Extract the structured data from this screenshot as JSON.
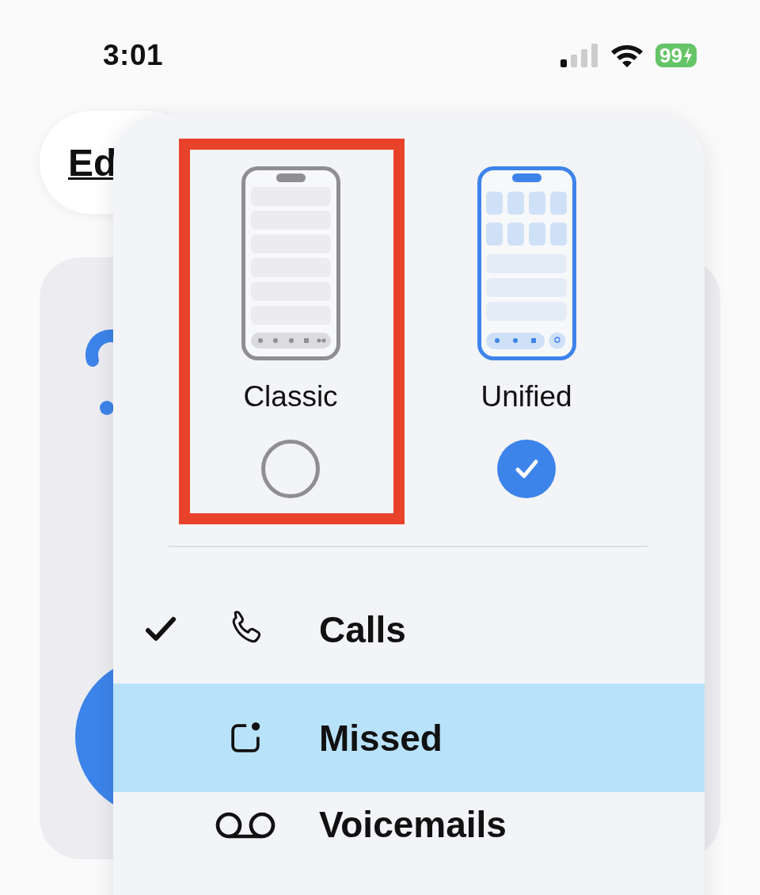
{
  "status_bar": {
    "time": "3:01",
    "battery": "99"
  },
  "background": {
    "edit_button": "Ed"
  },
  "layout_menu": {
    "options": [
      {
        "label": "Classic",
        "kind": "classic",
        "selected": false,
        "annotated": true
      },
      {
        "label": "Unified",
        "kind": "unified",
        "selected": true,
        "annotated": false
      }
    ],
    "items": [
      {
        "label": "Calls",
        "kind": "phone",
        "checked": true,
        "highlighted": false
      },
      {
        "label": "Missed",
        "kind": "missed",
        "checked": false,
        "highlighted": true
      },
      {
        "label": "Voicemails",
        "kind": "voicemail",
        "checked": false,
        "highlighted": false
      }
    ]
  }
}
